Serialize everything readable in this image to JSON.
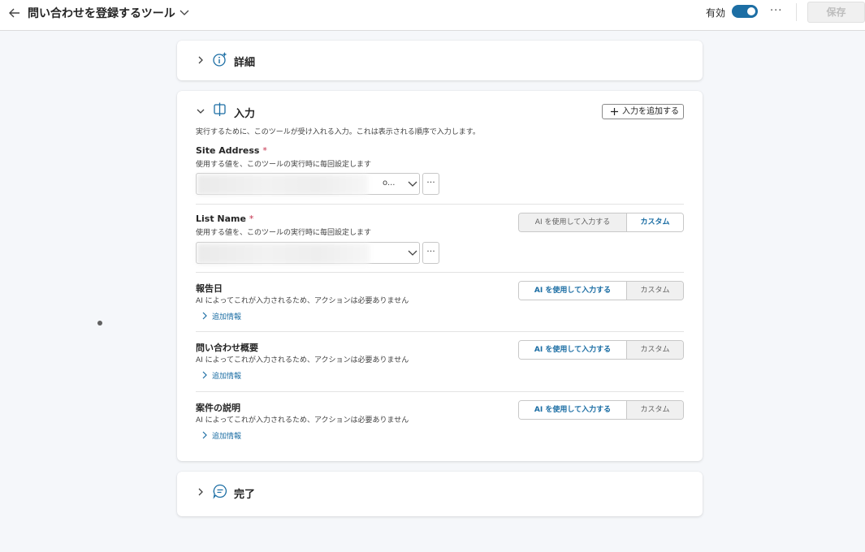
{
  "header": {
    "title": "問い合わせを登録するツール",
    "enabled_label": "有効",
    "enabled": true,
    "more_label": "···",
    "save_label": "保存"
  },
  "sections": {
    "details": {
      "title": "詳細"
    },
    "inputs": {
      "title": "入力",
      "add_button_label": "入力を追加する",
      "description": "実行するために、このツールが受け入れる入力。これは表示される順序で入力します。"
    },
    "completion": {
      "title": "完了"
    }
  },
  "inputs": [
    {
      "label": "Site Address",
      "required_mark": "*",
      "sublabel": "使用する値を、このツールの実行時に毎回設定します",
      "dropdown_value": "o...",
      "more_label": "···"
    },
    {
      "label": "List Name",
      "required_mark": "*",
      "sublabel": "使用する値を、このツールの実行時に毎回設定します",
      "more_label": "···",
      "mode_ai": "AI を使用して入力する",
      "mode_custom": "カスタム",
      "selected": "custom"
    },
    {
      "label": "報告日",
      "sublabel": "AI によってこれが入力されるため、アクションは必要ありません",
      "more_info": "追加情報",
      "mode_ai": "AI を使用して入力する",
      "mode_custom": "カスタム",
      "selected": "ai"
    },
    {
      "label": "問い合わせ概要",
      "sublabel": "AI によってこれが入力されるため、アクションは必要ありません",
      "more_info": "追加情報",
      "mode_ai": "AI を使用して入力する",
      "mode_custom": "カスタム",
      "selected": "ai"
    },
    {
      "label": "案件の説明",
      "sublabel": "AI によってこれが入力されるため、アクションは必要ありません",
      "more_info": "追加情報",
      "mode_ai": "AI を使用して入力する",
      "mode_custom": "カスタム",
      "selected": "ai"
    }
  ],
  "colors": {
    "accent": "#1c6ea4",
    "required": "#c4314b"
  }
}
